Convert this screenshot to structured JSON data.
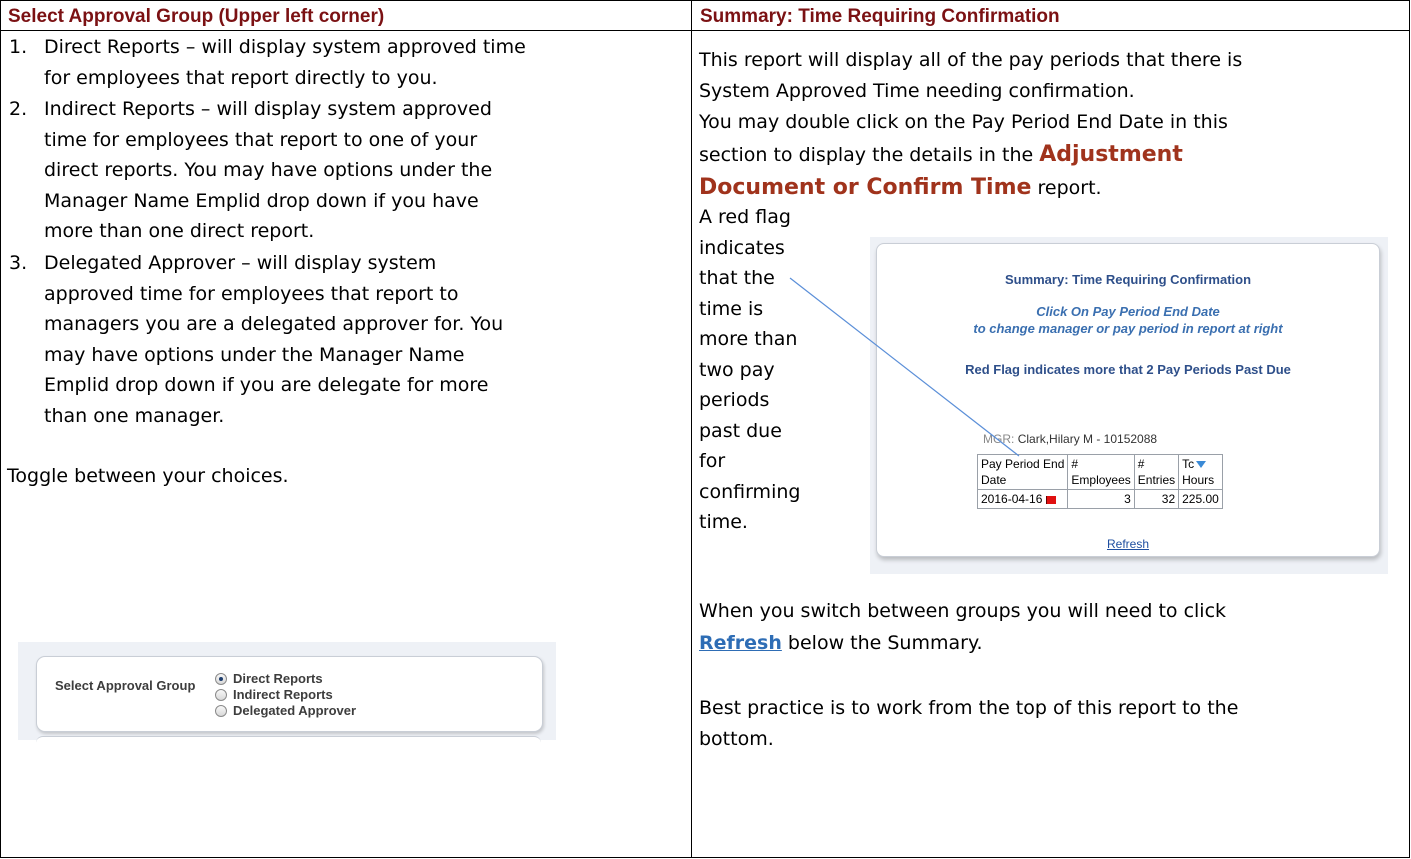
{
  "left": {
    "heading": "Select Approval Group (Upper left corner)",
    "steps": [
      {
        "num": "1.",
        "lines": [
          "Direct Reports – will display system approved time",
          "for employees that report directly to you."
        ]
      },
      {
        "num": "2.",
        "lines": [
          "Indirect Reports – will display system approved",
          "time for employees that report to one of your",
          "direct reports.  You may have options under the",
          "Manager Name Emplid drop down if you have",
          "more than one direct report."
        ]
      },
      {
        "num": "3.",
        "lines": [
          "Delegated Approver – will display system",
          "approved time for employees that report to",
          "managers you are a delegated approver for.  You",
          "may have options under the Manager Name",
          "Emplid drop down if you are delegate for more",
          "than one manager."
        ]
      }
    ],
    "toggle_text": "Toggle between your choices.",
    "approval_widget": {
      "label": "Select Approval Group",
      "options": [
        "Direct Reports",
        "Indirect Reports",
        "Delegated Approver"
      ],
      "selected_index": 0
    }
  },
  "right": {
    "heading": "Summary: Time Requiring Confirmation",
    "para1_line1": "This report will display all of the pay periods that there is",
    "para1_line2": "System Approved Time needing confirmation.",
    "para2_line1": "You may double click on the Pay Period End Date in this",
    "para2_line2_pre": "section to display the details in the ",
    "para2_line2_strong": "Adjustment",
    "para2_line3_strong": "Document or Confirm Time",
    "para2_line3_post": " report.",
    "flag_note": [
      "A red flag",
      "indicates",
      "that the",
      "time is",
      "more than",
      "two pay",
      "periods",
      "past due",
      "for",
      "confirming",
      "time."
    ],
    "switch_pre": "When you switch between groups you will need to click",
    "switch_link": "Refresh",
    "switch_post": " below the Summary.",
    "best_line1": "Best practice is to work from the top of this report to the",
    "best_line2": "bottom.",
    "summary_widget": {
      "title": "Summary: Time Requiring Confirmation",
      "instr1": "Click On Pay Period End Date",
      "instr2": "to change manager or pay period in report at right",
      "flag_msg": "Red Flag indicates more that 2 Pay Periods Past Due",
      "mgr_label": "MGR:",
      "mgr_value": "Clark,Hilary M - 10152088",
      "columns": [
        "Pay Period End Date",
        "# Employees",
        "# Entries",
        "Tc Hours"
      ],
      "col_head": {
        "c1a": "Pay Period End",
        "c1b": "Date",
        "c2a": "#",
        "c2b": "Employees",
        "c3a": "#",
        "c3b": "Entries",
        "c4a": "Tc",
        "c4b": "Hours"
      },
      "row": {
        "date": "2016-04-16",
        "employees": "3",
        "entries": "32",
        "hours": "225.00"
      },
      "refresh": "Refresh"
    }
  }
}
